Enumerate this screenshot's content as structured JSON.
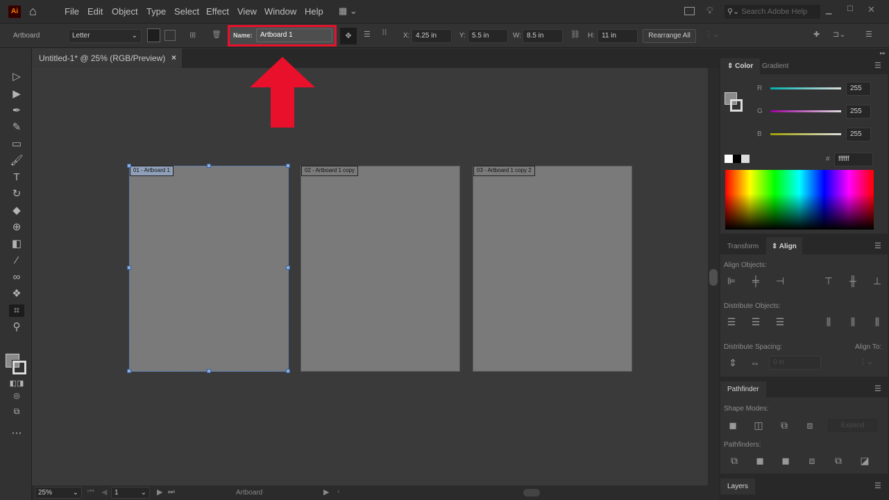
{
  "menubar": {
    "logo": "Ai",
    "items": [
      "File",
      "Edit",
      "Object",
      "Type",
      "Select",
      "Effect",
      "View",
      "Window",
      "Help"
    ],
    "search_placeholder": "Search Adobe Help"
  },
  "control": {
    "mode": "Artboard",
    "preset": "Letter",
    "name_label": "Name:",
    "name_value": "Artboard 1",
    "x_label": "X:",
    "x": "4.25 in",
    "y_label": "Y:",
    "y": "5.5 in",
    "w_label": "W:",
    "w": "8.5 in",
    "h_label": "H:",
    "h": "11 in",
    "rearrange": "Rearrange All"
  },
  "document": {
    "tab": "Untitled-1* @ 25% (RGB/Preview)",
    "close": "×"
  },
  "artboards": [
    "01 - Artboard 1",
    "02 - Artboard 1 copy",
    "03 - Artboard 1 copy 2"
  ],
  "status": {
    "zoom": "25%",
    "page": "1",
    "tool": "Artboard"
  },
  "color_panel": {
    "tabs": [
      "Color",
      "Gradient"
    ],
    "r_label": "R",
    "r": "255",
    "g_label": "G",
    "g": "255",
    "b_label": "B",
    "b": "255",
    "hex_label": "#",
    "hex": "ffffff"
  },
  "align_panel": {
    "tabs": [
      "Transform",
      "Align"
    ],
    "align_objects": "Align Objects:",
    "distribute_objects": "Distribute Objects:",
    "distribute_spacing": "Distribute Spacing:",
    "align_to": "Align To:",
    "spacing_value": "0 in"
  },
  "pathfinder_panel": {
    "title": "Pathfinder",
    "shape_modes": "Shape Modes:",
    "expand": "Expand",
    "pathfinders": "Pathfinders:"
  },
  "layers_panel": {
    "title": "Layers"
  },
  "annotation": {
    "highlight_color": "#e8102a"
  }
}
